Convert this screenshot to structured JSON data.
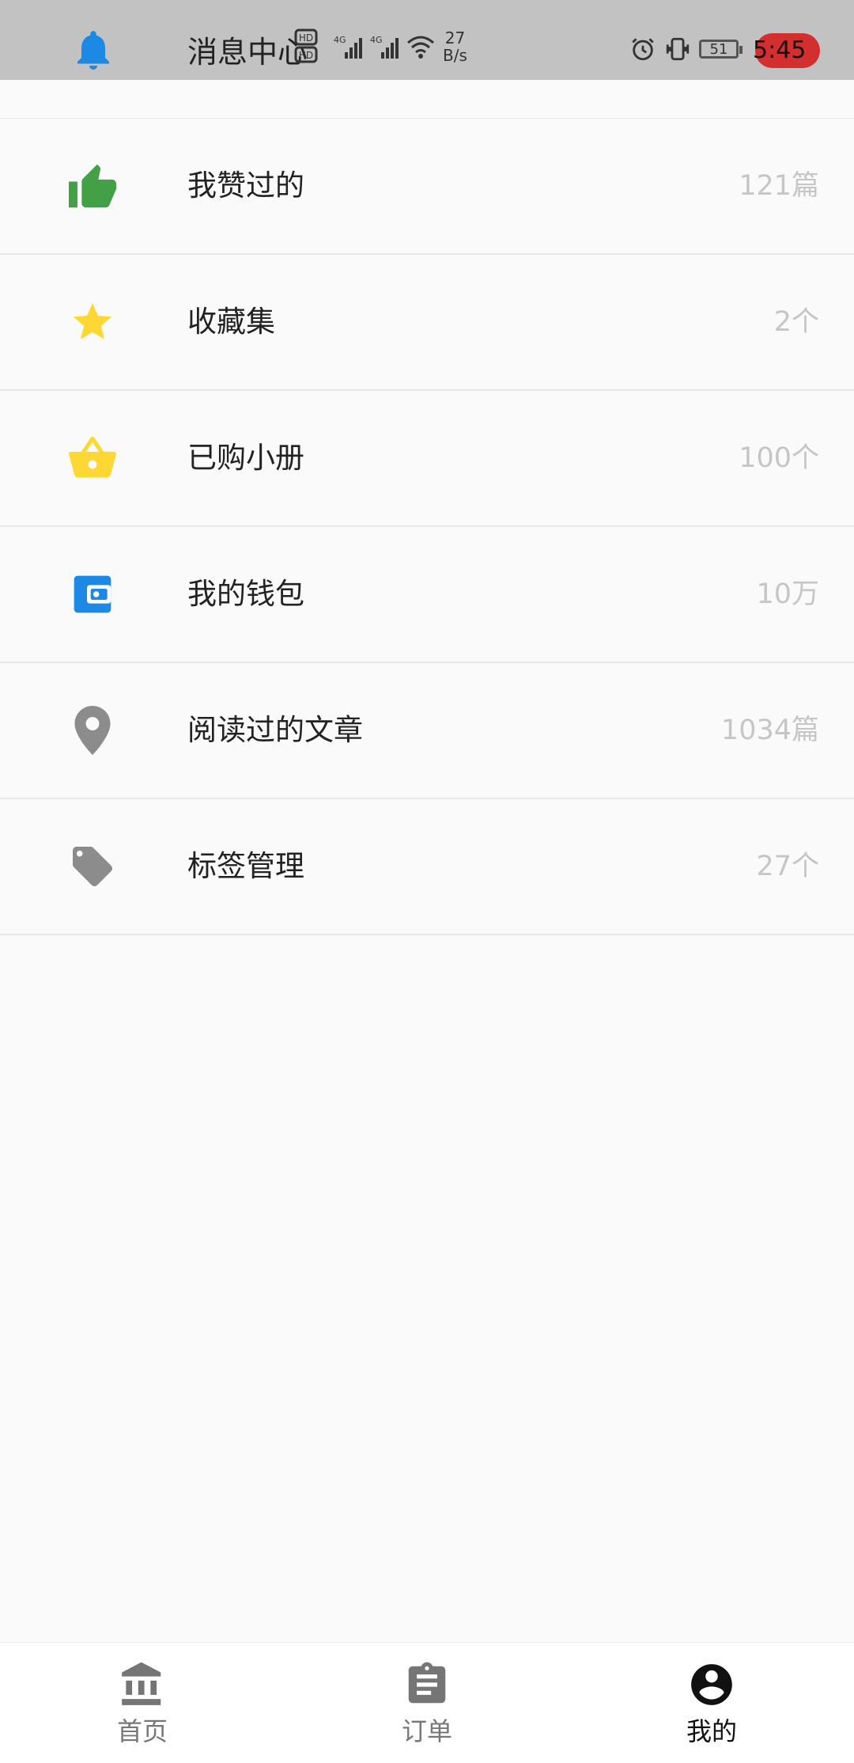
{
  "header": {
    "title": "消息中心",
    "network_speed_value": "27",
    "network_speed_unit": "B/s",
    "battery_level": "51",
    "time": "5:45"
  },
  "menu": {
    "items": [
      {
        "label": "我赞过的",
        "value": "121篇",
        "icon": "thumbs-up-icon",
        "color": "#43a047"
      },
      {
        "label": "收藏集",
        "value": "2个",
        "icon": "star-icon",
        "color": "#fdd835"
      },
      {
        "label": "已购小册",
        "value": "100个",
        "icon": "basket-icon",
        "color": "#fdd835"
      },
      {
        "label": "我的钱包",
        "value": "10万",
        "icon": "wallet-icon",
        "color": "#1e88e5"
      },
      {
        "label": "阅读过的文章",
        "value": "1034篇",
        "icon": "location-pin-icon",
        "color": "#8c8c8c"
      },
      {
        "label": "标签管理",
        "value": "27个",
        "icon": "tag-icon",
        "color": "#8c8c8c"
      }
    ]
  },
  "bottom_nav": {
    "items": [
      {
        "label": "首页",
        "icon": "bank-icon"
      },
      {
        "label": "订单",
        "icon": "clipboard-icon"
      },
      {
        "label": "我的",
        "icon": "account-circle-icon",
        "active": true
      }
    ]
  }
}
